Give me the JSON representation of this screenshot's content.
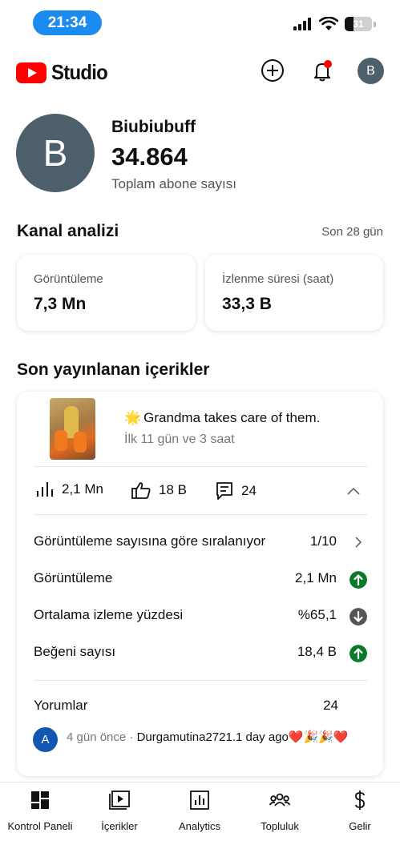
{
  "status_bar": {
    "time": "21:34",
    "battery": "31"
  },
  "app": {
    "logo_text": "Studio",
    "avatar_letter": "B"
  },
  "channel": {
    "avatar_letter": "B",
    "name": "Biubiubuff",
    "subscriber_count": "34.864",
    "subscriber_label": "Toplam abone sayısı"
  },
  "analytics": {
    "title": "Kanal analizi",
    "period": "Son 28 gün",
    "cards": [
      {
        "label": "Görüntüleme",
        "value": "7,3 Mn"
      },
      {
        "label": "İzlenme süresi (saat)",
        "value": "33,3 B"
      }
    ]
  },
  "recent": {
    "title": "Son yayınlanan içerikler",
    "video": {
      "title": "Grandma takes care of them.",
      "title_emoji": "🌟",
      "age": "İlk 11 gün ve 3 saat",
      "views": "2,1 Mn",
      "likes": "18 B",
      "comments": "24"
    },
    "rows": [
      {
        "label": "Görüntüleme sayısına göre sıralanıyor",
        "value": "1/10"
      },
      {
        "label": "Görüntüleme",
        "value": "2,1 Mn",
        "trend": "up"
      },
      {
        "label": "Ortalama izleme yüzdesi",
        "value": "%65,1",
        "trend": "down"
      },
      {
        "label": "Beğeni sayısı",
        "value": "18,4 B",
        "trend": "up"
      }
    ],
    "comments_label": "Yorumlar",
    "comments_count": "24",
    "comment": {
      "avatar_letter": "A",
      "ago": "4 gün önce",
      "separator": "·",
      "text": "Durgamutina2721.1 day ago❤️🎉🎉❤️"
    }
  },
  "nav": [
    {
      "label": "Kontrol Paneli",
      "icon": "dashboard-icon"
    },
    {
      "label": "İçerikler",
      "icon": "content-icon"
    },
    {
      "label": "Analytics",
      "icon": "analytics-icon"
    },
    {
      "label": "Topluluk",
      "icon": "community-icon"
    },
    {
      "label": "Gelir",
      "icon": "dollar-icon"
    }
  ],
  "colors": {
    "brand_red": "#ff0000",
    "avatar_slate": "#4d5f6b",
    "trend_up": "#0a7a2a",
    "trend_down": "#555555",
    "time_pill": "#1a8cf0"
  }
}
